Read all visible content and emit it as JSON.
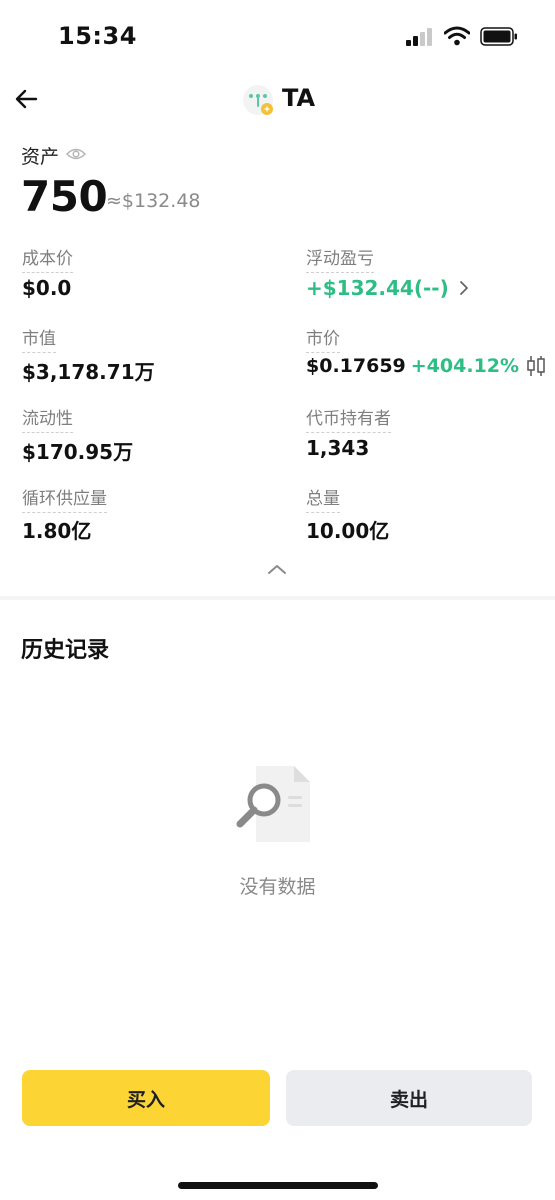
{
  "status_bar": {
    "time": "15:34"
  },
  "header": {
    "title": "TA"
  },
  "asset": {
    "label": "资产",
    "amount": "750",
    "approx": "≈$132.48"
  },
  "metrics": {
    "cost_price": {
      "label": "成本价",
      "value": "$0.0"
    },
    "floating_pnl": {
      "label": "浮动盈亏",
      "value": "+$132.44(--)"
    },
    "market_cap": {
      "label": "市值",
      "value": "$3,178.71万"
    },
    "price": {
      "label": "市价",
      "value": "$0.17659",
      "change": "+404.12%"
    },
    "liquidity": {
      "label": "流动性",
      "value": "$170.95万"
    },
    "holders": {
      "label": "代币持有者",
      "value": "1,343"
    },
    "circulating_supply": {
      "label": "循环供应量",
      "value": "1.80亿"
    },
    "total_supply": {
      "label": "总量",
      "value": "10.00亿"
    }
  },
  "history": {
    "title": "历史记录",
    "empty_text": "没有数据"
  },
  "actions": {
    "buy": "买入",
    "sell": "卖出"
  },
  "colors": {
    "positive": "#2ebd85",
    "buy_button": "#fcd535",
    "sell_button": "#eaecef"
  }
}
